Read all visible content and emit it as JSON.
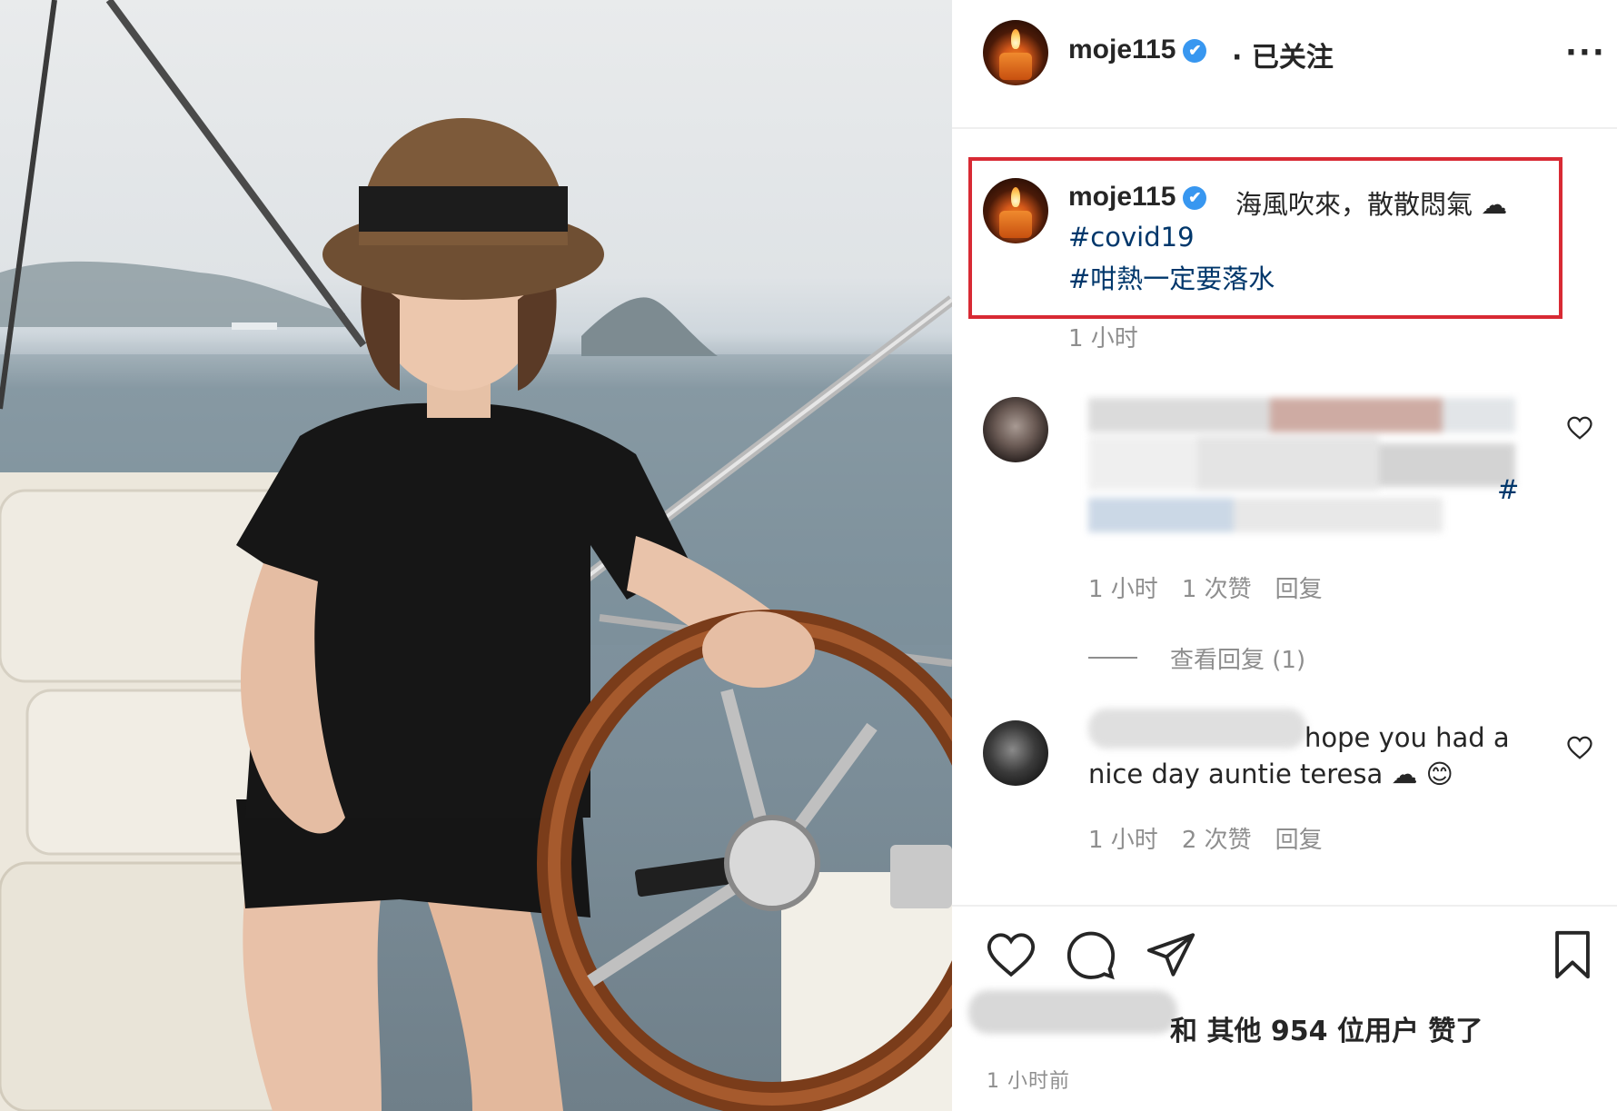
{
  "post": {
    "username": "moje115",
    "verified_mark": "✔",
    "follow_status": "· 已关注",
    "more_label": "···"
  },
  "caption": {
    "username": "moje115",
    "text": "海風吹來，散散悶氣",
    "emoji": "☁",
    "hashtags": [
      "#covid19",
      "#咁熱一定要落水"
    ],
    "time": "1 小时"
  },
  "comments": [
    {
      "text_suffix": "#",
      "time": "1 小时",
      "likes": "1 次赞",
      "reply": "回复",
      "view_replies": "查看回复 (1)"
    },
    {
      "text_line1": "hope you had a",
      "text_line2": "nice day auntie teresa",
      "emoji": "☁ 😊",
      "time": "1 小时",
      "likes": "2 次赞",
      "reply": "回复"
    }
  ],
  "actions": {
    "like_icon": "heart-icon",
    "comment_icon": "comment-icon",
    "share_icon": "paper-plane-icon",
    "save_icon": "bookmark-icon"
  },
  "likes_text": "和 其他 954 位用户 赞了",
  "posted_ago": "1 小时前",
  "colors": {
    "highlight_border": "#d82a34",
    "verified": "#3897f0",
    "hashtag": "#00376b",
    "meta_gray": "#8e8e8e"
  }
}
